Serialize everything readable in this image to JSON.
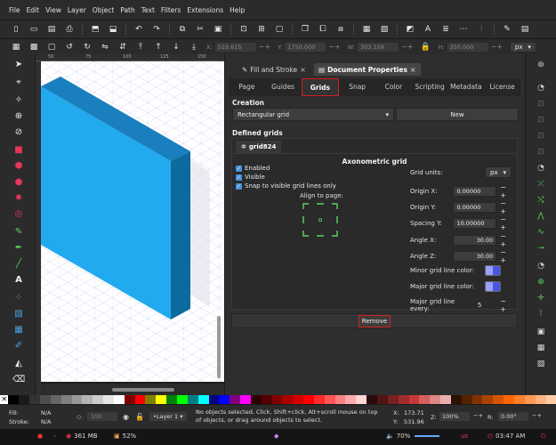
{
  "menubar": [
    "File",
    "Edit",
    "View",
    "Layer",
    "Object",
    "Path",
    "Text",
    "Filters",
    "Extensions",
    "Help"
  ],
  "coords": {
    "x_label": "X:",
    "x": "519.615",
    "y_label": "Y:",
    "y": "1750.000",
    "w_label": "W:",
    "w": "303.109",
    "h_label": "H:",
    "h": "350.000",
    "unit": "px"
  },
  "ruler_ticks": [
    "50",
    "75",
    "100",
    "125",
    "150"
  ],
  "panel": {
    "tabs": [
      {
        "label": "Fill and Stroke",
        "close": "×"
      },
      {
        "label": "Document Properties",
        "close": "×"
      }
    ],
    "subtabs": [
      "Page",
      "Guides",
      "Grids",
      "Snap",
      "Color",
      "Scripting",
      "Metadata",
      "License"
    ],
    "creation_header": "Creation",
    "grid_type": "Rectangular grid",
    "new_button": "New",
    "defined_header": "Defined grids",
    "grid_tab": "grid824",
    "grid_title": "Axonometric grid",
    "checkboxes": [
      "Enabled",
      "Visible",
      "Snap to visible grid lines only"
    ],
    "align_label": "Align to page:",
    "props": [
      {
        "label": "Grid units:",
        "value": "px"
      },
      {
        "label": "Origin X:",
        "value": "0.00000"
      },
      {
        "label": "Origin Y:",
        "value": "0.00000"
      },
      {
        "label": "Spacing Y:",
        "value": "10.00000"
      },
      {
        "label": "Angle X:",
        "value": "30.00"
      },
      {
        "label": "Angle Z:",
        "value": "30.00"
      },
      {
        "label": "Minor grid line color:",
        "value": ""
      },
      {
        "label": "Major grid line color:",
        "value": ""
      },
      {
        "label": "Major grid line every:",
        "value": "5"
      }
    ],
    "remove_button": "Remove"
  },
  "statusbar": {
    "fill_label": "Fill:",
    "fill": "N/A",
    "stroke_label": "Stroke:",
    "stroke": "N/A",
    "opacity_label": "O:",
    "opacity": "100",
    "layer": "•Layer 1",
    "message": "No objects selected. Click, Shift+click, Alt+scroll mouse on top of objects, or drag around objects to select.",
    "x_label": "X:",
    "x": "173.71",
    "y_label": "Y:",
    "y": "531.96",
    "z_label": "Z:",
    "zoom": "100%",
    "r_label": "R:",
    "rotation": "0.00°"
  },
  "taskbar": {
    "memory": "361 MB",
    "cpu": "52%",
    "volume": "70%",
    "lang": "us",
    "time": "03:47 AM"
  },
  "colors": {
    "box_front": "#22aaee",
    "box_top": "#1a7fbf",
    "box_side": "#0d6a9e",
    "highlight": "#d02020"
  },
  "icons": {
    "minor_color": "swatch-icon",
    "major_color": "swatch-icon"
  }
}
